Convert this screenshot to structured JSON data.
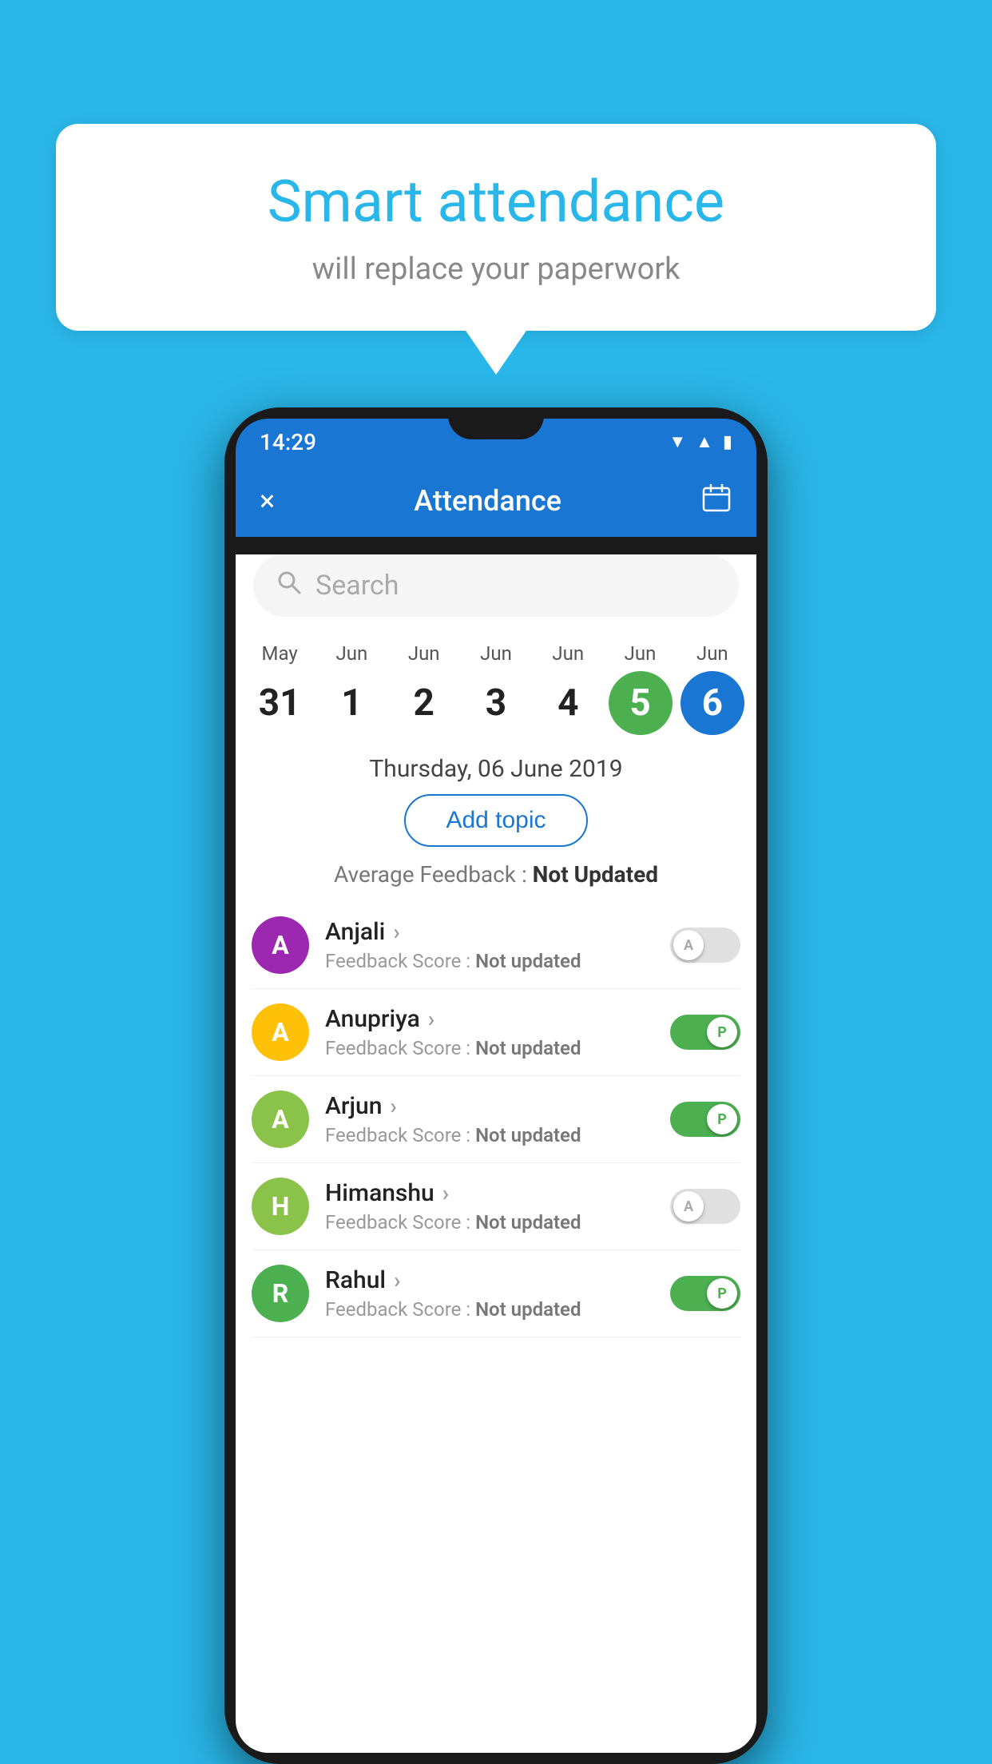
{
  "background_color": "#29B6E8",
  "speech_bubble": {
    "title": "Smart attendance",
    "subtitle": "will replace your paperwork"
  },
  "status_bar": {
    "time": "14:29",
    "icons": [
      "wifi",
      "signal",
      "battery"
    ]
  },
  "app_bar": {
    "title": "Attendance",
    "close_label": "×",
    "calendar_label": "📅"
  },
  "search": {
    "placeholder": "Search"
  },
  "calendar": {
    "days": [
      {
        "month": "May",
        "date": "31",
        "state": "normal"
      },
      {
        "month": "Jun",
        "date": "1",
        "state": "normal"
      },
      {
        "month": "Jun",
        "date": "2",
        "state": "normal"
      },
      {
        "month": "Jun",
        "date": "3",
        "state": "normal"
      },
      {
        "month": "Jun",
        "date": "4",
        "state": "normal"
      },
      {
        "month": "Jun",
        "date": "5",
        "state": "today"
      },
      {
        "month": "Jun",
        "date": "6",
        "state": "selected"
      }
    ],
    "selected_date_label": "Thursday, 06 June 2019"
  },
  "add_topic_button": "Add topic",
  "avg_feedback": {
    "label": "Average Feedback : ",
    "value": "Not Updated"
  },
  "students": [
    {
      "name": "Anjali",
      "avatar_letter": "A",
      "avatar_color": "#9C27B0",
      "feedback_label": "Feedback Score : ",
      "feedback_value": "Not updated",
      "attendance": "absent"
    },
    {
      "name": "Anupriya",
      "avatar_letter": "A",
      "avatar_color": "#FFC107",
      "feedback_label": "Feedback Score : ",
      "feedback_value": "Not updated",
      "attendance": "present"
    },
    {
      "name": "Arjun",
      "avatar_letter": "A",
      "avatar_color": "#8BC34A",
      "feedback_label": "Feedback Score : ",
      "feedback_value": "Not updated",
      "attendance": "present"
    },
    {
      "name": "Himanshu",
      "avatar_letter": "H",
      "avatar_color": "#8BC34A",
      "feedback_label": "Feedback Score : ",
      "feedback_value": "Not updated",
      "attendance": "absent"
    },
    {
      "name": "Rahul",
      "avatar_letter": "R",
      "avatar_color": "#4CAF50",
      "feedback_label": "Feedback Score : ",
      "feedback_value": "Not updated",
      "attendance": "present"
    }
  ]
}
